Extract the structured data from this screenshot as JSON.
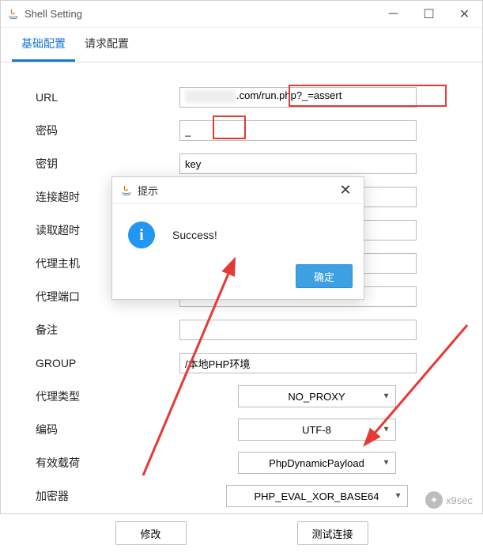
{
  "window": {
    "title": "Shell Setting"
  },
  "tabs": {
    "basic": "基础配置",
    "request": "请求配置"
  },
  "labels": {
    "url": "URL",
    "password": "密码",
    "secret": "密钥",
    "conn_timeout": "连接超时",
    "read_timeout": "读取超时",
    "proxy_host": "代理主机",
    "proxy_port": "代理端口",
    "remark": "备注",
    "group": "GROUP",
    "proxy_type": "代理类型",
    "encoding": "编码",
    "payload": "有效载荷",
    "encryptor": "加密器"
  },
  "values": {
    "url_suffix": ".com/run.php?_=assert",
    "password": "_",
    "secret": "key",
    "conn_timeout": "",
    "read_timeout": "",
    "proxy_host": "",
    "proxy_port": "",
    "remark": "",
    "group": "/本地PHP环境",
    "proxy_type": "NO_PROXY",
    "encoding": "UTF-8",
    "payload": "PhpDynamicPayload",
    "encryptor": "PHP_EVAL_XOR_BASE64"
  },
  "buttons": {
    "modify": "修改",
    "test": "测试连接"
  },
  "dialog": {
    "title": "提示",
    "message": "Success!",
    "ok": "确定"
  },
  "watermark": "x9sec",
  "annotations": {
    "highlight_color": "#e53935",
    "arrow_color": "#e53935"
  }
}
